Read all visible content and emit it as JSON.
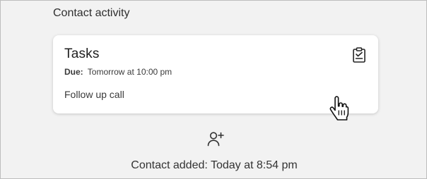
{
  "section": {
    "title": "Contact activity"
  },
  "task_card": {
    "title": "Tasks",
    "due_label": "Due:",
    "due_value": "Tomorrow at 10:00 pm",
    "description": "Follow up call",
    "icon": "clipboard-check-icon"
  },
  "activity": {
    "icon": "add-user-icon",
    "text": "Contact added: Today at 8:54 pm"
  },
  "colors": {
    "background": "#f2f2f2",
    "card": "#ffffff",
    "text": "#2b2b2b"
  }
}
